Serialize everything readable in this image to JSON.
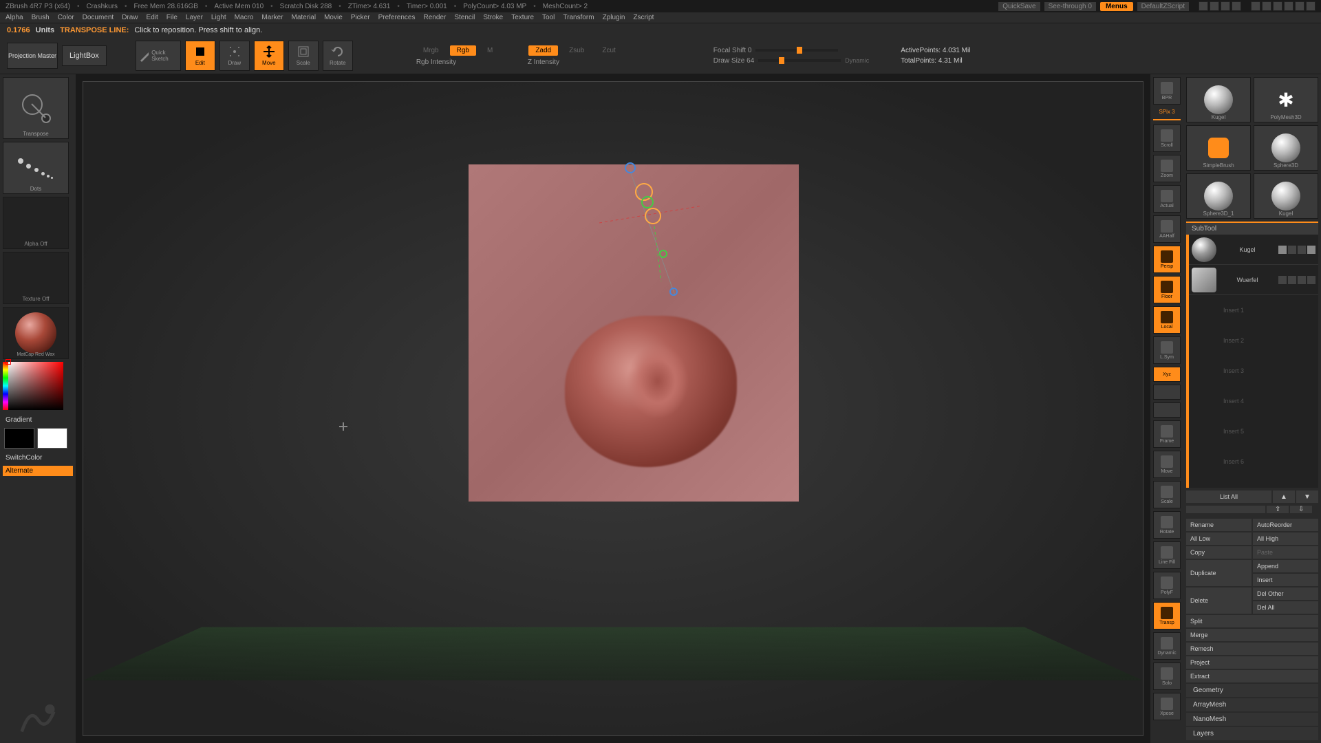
{
  "title_bar": {
    "app": "ZBrush 4R7 P3 (x64)",
    "doc": "Crashkurs",
    "free_mem": "Free Mem 28.616GB",
    "active_mem": "Active Mem 010",
    "scratch": "Scratch Disk 288",
    "ztime": "ZTime> 4.631",
    "timer": "Timer> 0.001",
    "polycount": "PolyCount> 4.03 MP",
    "meshcount": "MeshCount> 2",
    "quicksave": "QuickSave",
    "seethrough": "See-through  0",
    "menus": "Menus",
    "script": "DefaultZScript"
  },
  "menu": [
    "Alpha",
    "Brush",
    "Color",
    "Document",
    "Draw",
    "Edit",
    "File",
    "Layer",
    "Light",
    "Macro",
    "Marker",
    "Material",
    "Movie",
    "Picker",
    "Preferences",
    "Render",
    "Stencil",
    "Stroke",
    "Texture",
    "Tool",
    "Transform",
    "Zplugin",
    "Zscript"
  ],
  "status": {
    "value": "0.1766",
    "units": "Units",
    "mode": "TRANSPOSE LINE:",
    "hint": "Click to reposition. Press shift to align."
  },
  "toolbar": {
    "projection": "Projection Master",
    "lightbox": "LightBox",
    "quicksketch": "Quick Sketch",
    "edit": "Edit",
    "draw": "Draw",
    "move": "Move",
    "scale": "Scale",
    "rotate": "Rotate",
    "mrgb": "Mrgb",
    "rgb": "Rgb",
    "m": "M",
    "zadd": "Zadd",
    "zsub": "Zsub",
    "zcut": "Zcut",
    "rgb_intensity": "Rgb Intensity",
    "z_intensity": "Z Intensity",
    "focal_shift": "Focal Shift 0",
    "draw_size": "Draw Size 64",
    "dynamic": "Dynamic",
    "active_points": "ActivePoints: 4.031 Mil",
    "total_points": "TotalPoints: 4.31 Mil"
  },
  "left": {
    "brush": "Transpose",
    "stroke": "Dots",
    "alpha": "Alpha Off",
    "texture": "Texture Off",
    "material": "MatCap Red Wax",
    "gradient": "Gradient",
    "switchcolor": "SwitchColor",
    "alternate": "Alternate"
  },
  "nav": {
    "spix": "SPix 3",
    "items": [
      "BPR",
      "Scroll",
      "Zoom",
      "Actual",
      "AAHalf",
      "Persp",
      "Floor",
      "Local",
      "L.Sym",
      "Xyz",
      "",
      "",
      "Frame",
      "Move",
      "Scale",
      "Rotate",
      "Line Fill",
      "PolyF",
      "Transp",
      "Dynamic",
      "Solo",
      "Xpose"
    ]
  },
  "tools": {
    "grid": [
      {
        "name": "Kugel"
      },
      {
        "name": "PolyMesh3D"
      },
      {
        "name": "SimpleBrush"
      },
      {
        "name": "Sphere3D"
      },
      {
        "name": "Sphere3D_1"
      },
      {
        "name": "Kugel"
      }
    ],
    "subtool_header": "SubTool",
    "subtools": [
      {
        "name": "Kugel"
      },
      {
        "name": "Wuerfel"
      }
    ],
    "ghosts": [
      "Insert 1",
      "Insert 2",
      "Insert 3",
      "Insert 4",
      "Insert 5",
      "Insert 6"
    ],
    "list_all": "List All",
    "actions": {
      "rename": "Rename",
      "autoreorder": "AutoReorder",
      "all_low": "All Low",
      "all_high": "All High",
      "copy": "Copy",
      "paste": "Paste",
      "duplicate": "Duplicate",
      "append": "Append",
      "insert": "Insert",
      "delete": "Delete",
      "del_other": "Del Other",
      "del_all": "Del All",
      "split": "Split",
      "merge": "Merge",
      "remesh": "Remesh",
      "project": "Project",
      "extract": "Extract"
    },
    "accordions": [
      "Geometry",
      "ArrayMesh",
      "NanoMesh",
      "Layers"
    ]
  }
}
